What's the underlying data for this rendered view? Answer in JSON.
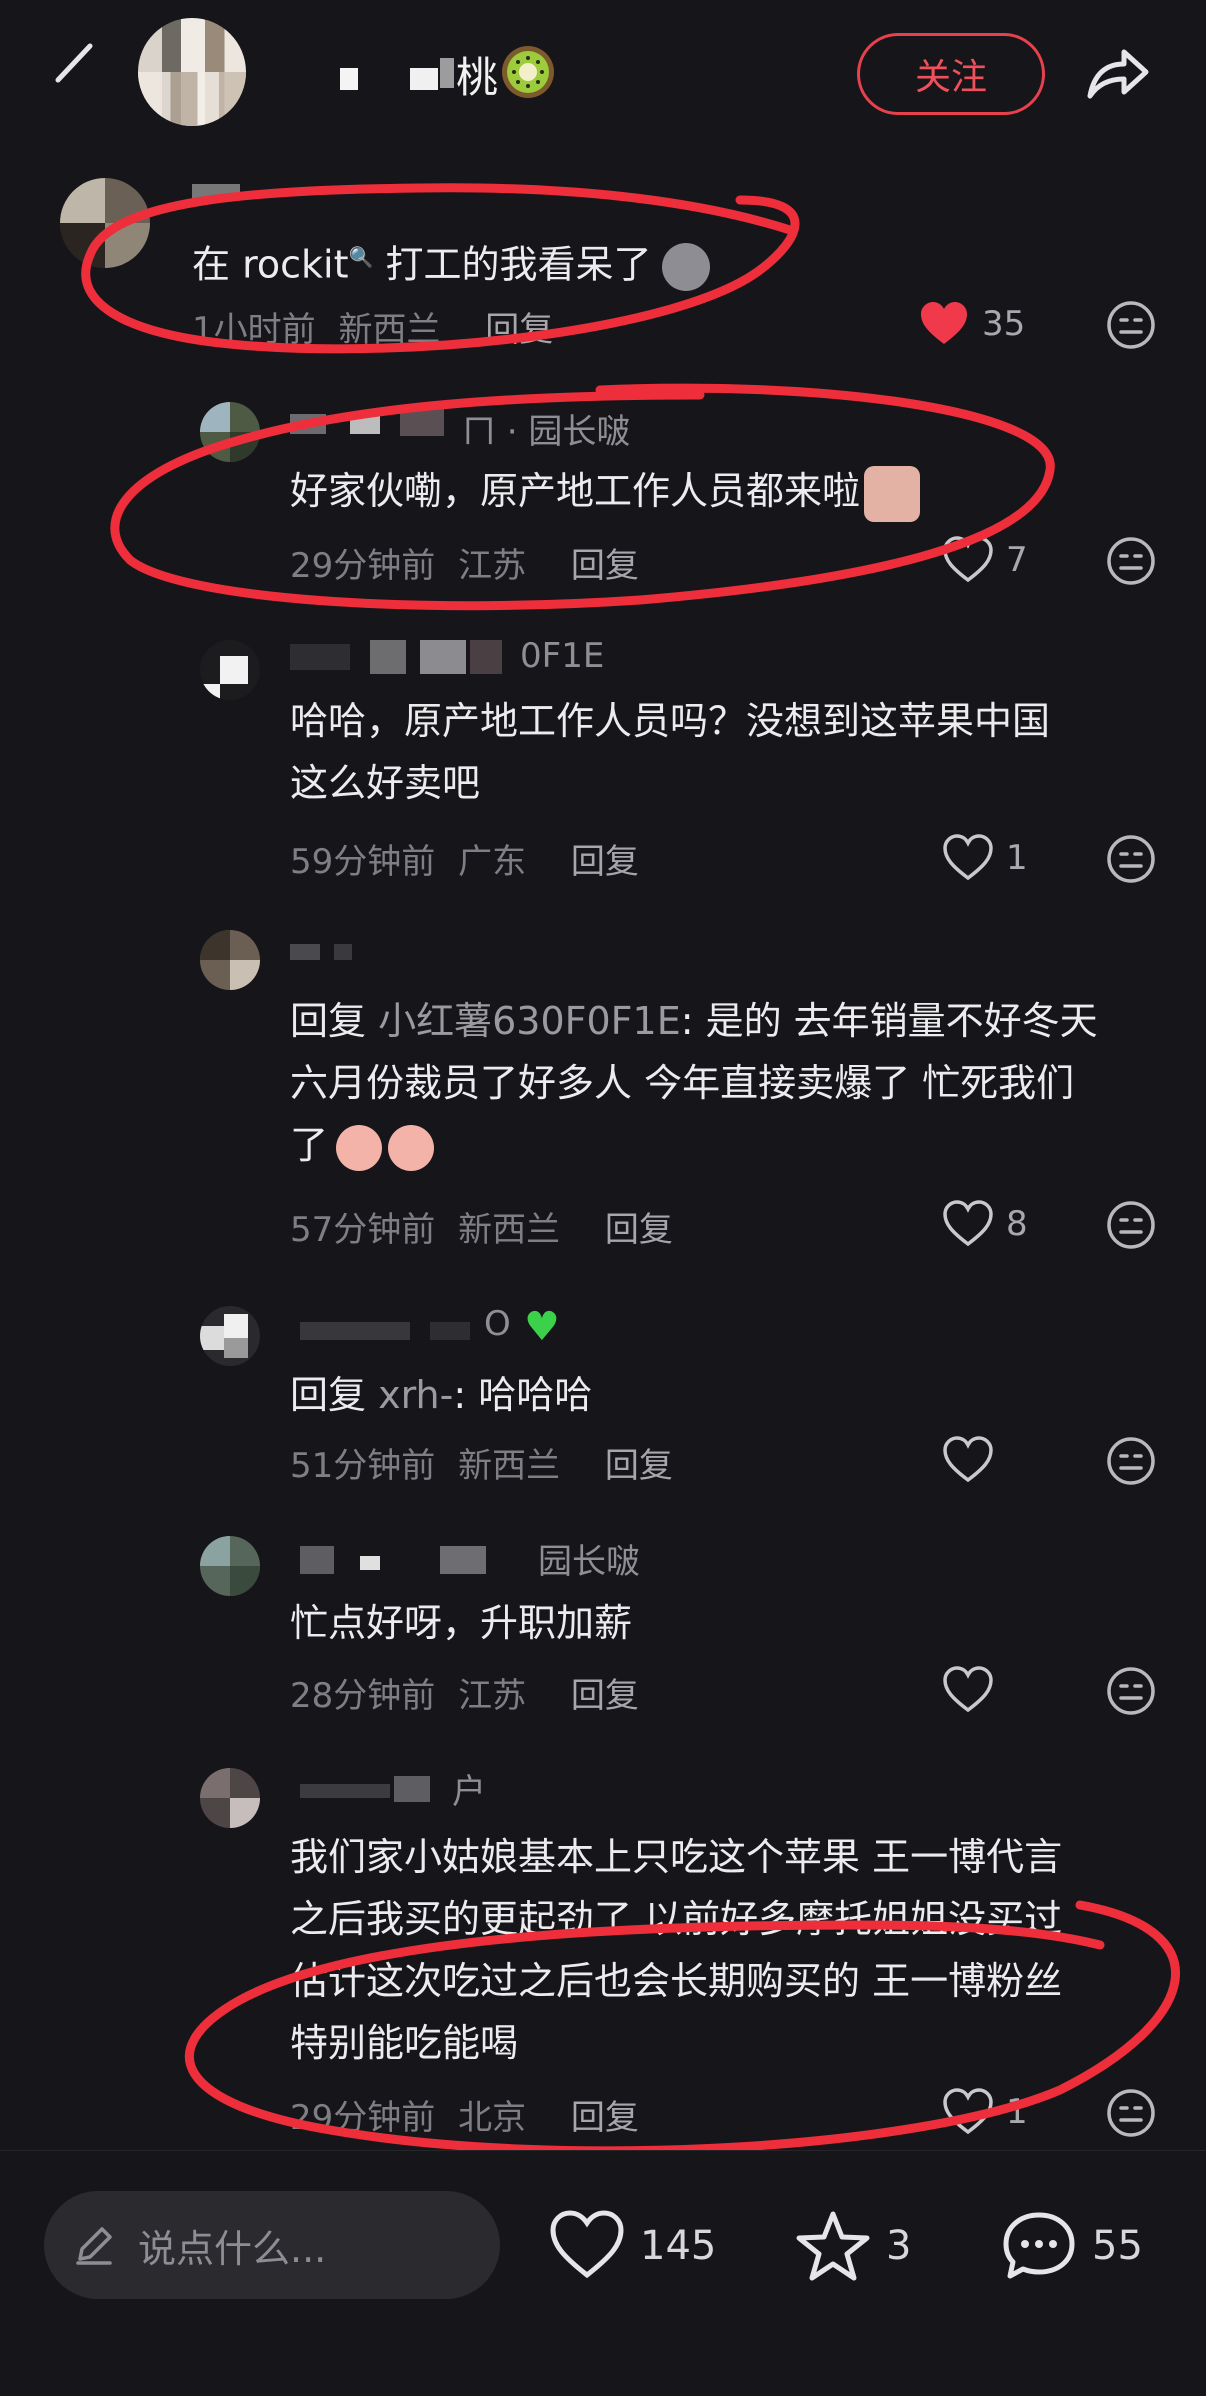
{
  "header": {
    "author_name_visible": "桃",
    "follow_label": "关注"
  },
  "comments": [
    {
      "text_before": "在 ",
      "text_brand": "rockit",
      "text_after": " 打工的我看呆了",
      "time": "1小时前",
      "location": "新西兰",
      "reply_label": "回复",
      "likes": "35",
      "liked": true
    },
    {
      "name_visible": "ㄇ · 园长啵",
      "text": "好家伙嘞，原产地工作人员都来啦",
      "time": "29分钟前",
      "location": "江苏",
      "reply_label": "回复",
      "likes": "7"
    },
    {
      "name_visible": "0F1E",
      "text": "哈哈，原产地工作人员吗？没想到这苹果中国\n这么好卖吧",
      "time": "59分钟前",
      "location": "广东",
      "reply_label": "回复",
      "likes": "1"
    },
    {
      "text_prefix": "回复 ",
      "reply_target": "小红薯630F0F1E",
      "text": ": 是的 去年销量不好冬天\n六月份裁员了好多人 今年直接卖爆了 忙死我们\n了",
      "time": "57分钟前",
      "location": "新西兰",
      "reply_label": "回复",
      "likes": "8"
    },
    {
      "name_visible": "O",
      "text_prefix": "回复 ",
      "reply_target": "xrh-",
      "text": ": 哈哈哈",
      "time": "51分钟前",
      "location": "新西兰",
      "reply_label": "回复",
      "likes": ""
    },
    {
      "name_visible": "园长啵",
      "text": "忙点好呀，升职加薪",
      "time": "28分钟前",
      "location": "江苏",
      "reply_label": "回复",
      "likes": ""
    },
    {
      "name_visible": "户",
      "text": "我们家小姑娘基本上只吃这个苹果 王一博代言\n之后我买的更起劲了 以前好多摩托姐姐没买过\n估计这次吃过之后也会长期购买的 王一博粉丝\n特别能吃能喝",
      "time": "29分钟前",
      "location": "北京",
      "reply_label": "回复",
      "likes": "1"
    }
  ],
  "bottom_bar": {
    "input_placeholder": "说点什么...",
    "likes": "145",
    "stars": "3",
    "comments": "55"
  },
  "colors": {
    "background": "#16161a",
    "accent_red": "#e8414e",
    "like_red": "#f0394b",
    "annotation_red": "#ee2e3a"
  }
}
